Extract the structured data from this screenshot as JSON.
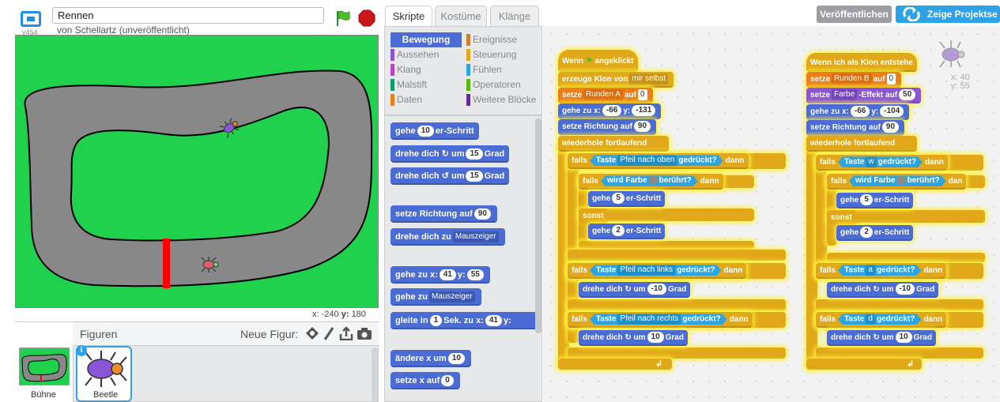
{
  "header": {
    "title": "Rennen",
    "byline": "von Schellartz (unveröffentlicht)",
    "version": "v454",
    "publish_label": "Veröffentlichen",
    "project_label": "Zeige Projektse"
  },
  "stage": {
    "coords_x_label": "x:",
    "coords_x": "-240",
    "coords_y_label": "y:",
    "coords_y": "180"
  },
  "sprites": {
    "header": "Figuren",
    "new_label": "Neue Figur:",
    "stage_label": "Bühne",
    "items": [
      {
        "name": "Beetle"
      }
    ]
  },
  "tabs": [
    "Skripte",
    "Kostüme",
    "Klänge"
  ],
  "categories": {
    "left": [
      "Bewegung",
      "Aussehen",
      "Klang",
      "Malstift",
      "Daten"
    ],
    "right": [
      "Ereignisse",
      "Steuerung",
      "Fühlen",
      "Operatoren",
      "Weitere Blöcke"
    ]
  },
  "palette": {
    "move_a": "gehe",
    "move_n": "10",
    "move_b": "er-Schritt",
    "turnr_a": "drehe dich",
    "turnr_b": "um",
    "turnr_n": "15",
    "turnr_c": "Grad",
    "turnl_a": "drehe dich",
    "turnl_b": "um",
    "turnl_n": "15",
    "turnl_c": "Grad",
    "dir_a": "setze Richtung auf",
    "dir_n": "90",
    "towards_a": "drehe dich zu",
    "towards_d": "Mauszeiger",
    "goto_a": "gehe zu x:",
    "goto_x": "41",
    "goto_b": "y:",
    "goto_y": "55",
    "gotoo_a": "gehe zu",
    "gotoo_d": "Mauszeiger",
    "glide_a": "gleite in",
    "glide_n": "1",
    "glide_b": "Sek. zu x:",
    "glide_x": "41",
    "glide_c": "y:",
    "chx_a": "ändere x um",
    "chx_n": "10",
    "setx_a": "setze x auf",
    "setx_n": "0"
  },
  "script1": {
    "hat_a": "Wenn",
    "hat_b": "angeklickt",
    "clone_a": "erzeuge Klon von",
    "clone_d": "mir selbst",
    "setvar_a": "setze",
    "setvar_d": "Runden A",
    "setvar_b": "auf",
    "setvar_n": "0",
    "goto_a": "gehe zu x:",
    "goto_x": "-66",
    "goto_b": "y:",
    "goto_y": "-131",
    "dir_a": "setze Richtung auf",
    "dir_n": "90",
    "forever": "wiederhole fortlaufend",
    "if1_a": "falls",
    "if1_b": "Taste",
    "if1_d": "Pfeil nach oben",
    "if1_c": "gedrückt?",
    "if1_e": "dann",
    "if2_a": "falls",
    "if2_b": "wird Farbe",
    "if2_c": "berührt?",
    "if2_e": "dann",
    "mv1_a": "gehe",
    "mv1_n": "5",
    "mv1_b": "er-Schritt",
    "else": "sonst",
    "mv2_a": "gehe",
    "mv2_n": "2",
    "mv2_b": "er-Schritt",
    "if3_a": "falls",
    "if3_b": "Taste",
    "if3_d": "Pfeil nach links",
    "if3_c": "gedrückt?",
    "if3_e": "dann",
    "t1_a": "drehe dich",
    "t1_b": "um",
    "t1_n": "-10",
    "t1_c": "Grad",
    "if4_a": "falls",
    "if4_b": "Taste",
    "if4_d": "Pfeil nach rechts",
    "if4_c": "gedrückt?",
    "if4_e": "dann",
    "t2_a": "drehe dich",
    "t2_b": "um",
    "t2_n": "10",
    "t2_c": "Grad"
  },
  "script2": {
    "hat": "Wenn ich als Klon entstehe",
    "setvar_a": "setze",
    "setvar_d": "Runden B",
    "setvar_b": "auf",
    "setvar_n": "0",
    "eff_a": "setze",
    "eff_d": "Farbe",
    "eff_b": "-Effekt auf",
    "eff_n": "50",
    "goto_a": "gehe zu x:",
    "goto_x": "-66",
    "goto_b": "y:",
    "goto_y": "-104",
    "dir_a": "setze Richtung auf",
    "dir_n": "90",
    "forever": "wiederhole fortlaufend",
    "if1_a": "falls",
    "if1_b": "Taste",
    "if1_d": "w",
    "if1_c": "gedrückt?",
    "if1_e": "dann",
    "if2_a": "falls",
    "if2_b": "wird Farbe",
    "if2_c": "berührt?",
    "if2_e": "dan",
    "mv1_a": "gehe",
    "mv1_n": "5",
    "mv1_b": "er-Schritt",
    "else": "sonst",
    "mv2_a": "gehe",
    "mv2_n": "2",
    "mv2_b": "er-Schritt",
    "if3_a": "falls",
    "if3_b": "Taste",
    "if3_d": "a",
    "if3_c": "gedrückt?",
    "if3_e": "dann",
    "t1_a": "drehe dich",
    "t1_b": "um",
    "t1_n": "-10",
    "t1_c": "Grad",
    "if4_a": "falls",
    "if4_b": "Taste",
    "if4_d": "d",
    "if4_c": "gedrückt?",
    "if4_e": "dann",
    "t2_a": "drehe dich",
    "t2_b": "um",
    "t2_n": "10",
    "t2_c": "Grad"
  },
  "sprite_info": {
    "x_label": "x:",
    "x": "40",
    "y_label": "y:",
    "y": "55"
  },
  "colors": {
    "stage_green": "#1fd14c",
    "track_gray": "#888888",
    "finish_red": "#ff0000",
    "motion": "#4a6cd4",
    "control": "#e1a91a",
    "data": "#ee7d16",
    "looks": "#8a55d7",
    "sensing": "#2ca5e2"
  }
}
